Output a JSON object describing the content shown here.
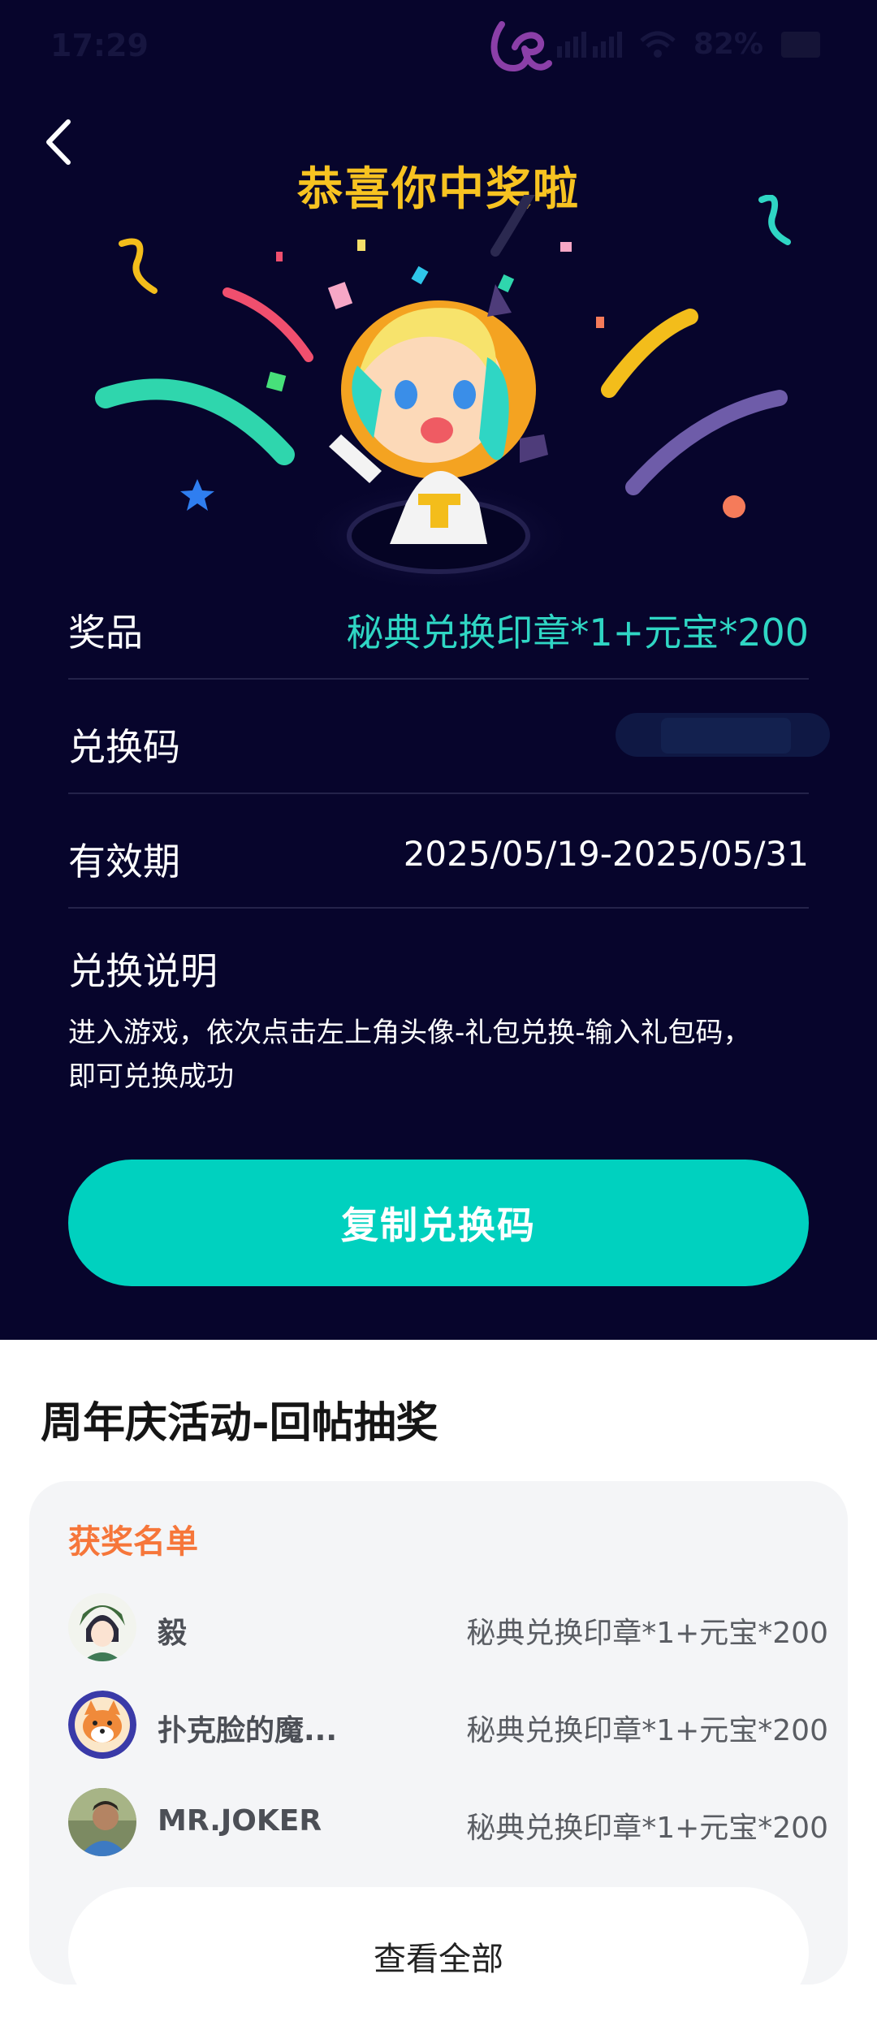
{
  "status_bar": {
    "time": "17:29",
    "battery": "82%"
  },
  "header": {
    "title": "恭喜你中奖啦"
  },
  "details": {
    "prize_label": "奖品",
    "prize_value": "秘典兑换印章*1+元宝*200",
    "code_label": "兑换码",
    "validity_label": "有效期",
    "validity_value": "2025/05/19-2025/05/31",
    "instructions_label": "兑换说明",
    "instructions_text_line1": "进入游戏，依次点击左上角头像-礼包兑换-输入礼包码，",
    "instructions_text_line2": "即可兑换成功"
  },
  "copy_button": {
    "label": "复制兑换码"
  },
  "activity": {
    "title": "周年庆活动-回帖抽奖",
    "winners_title": "获奖名单",
    "winners": [
      {
        "name": "毅",
        "prize": "秘典兑换印章*1+元宝*200"
      },
      {
        "name": "扑克脸的魔...",
        "prize": "秘典兑换印章*1+元宝*200"
      },
      {
        "name": "MR.JOKER",
        "prize": "秘典兑换印章*1+元宝*200"
      }
    ],
    "view_all_label": "查看全部"
  },
  "colors": {
    "accent": "#00d1bf",
    "title_gold": "#f7c321",
    "orange": "#f6763a",
    "background": "#07052c"
  },
  "icons": [
    "back-arrow-icon",
    "app-logo-icon",
    "signal-icon",
    "wifi-icon",
    "battery-icon"
  ]
}
